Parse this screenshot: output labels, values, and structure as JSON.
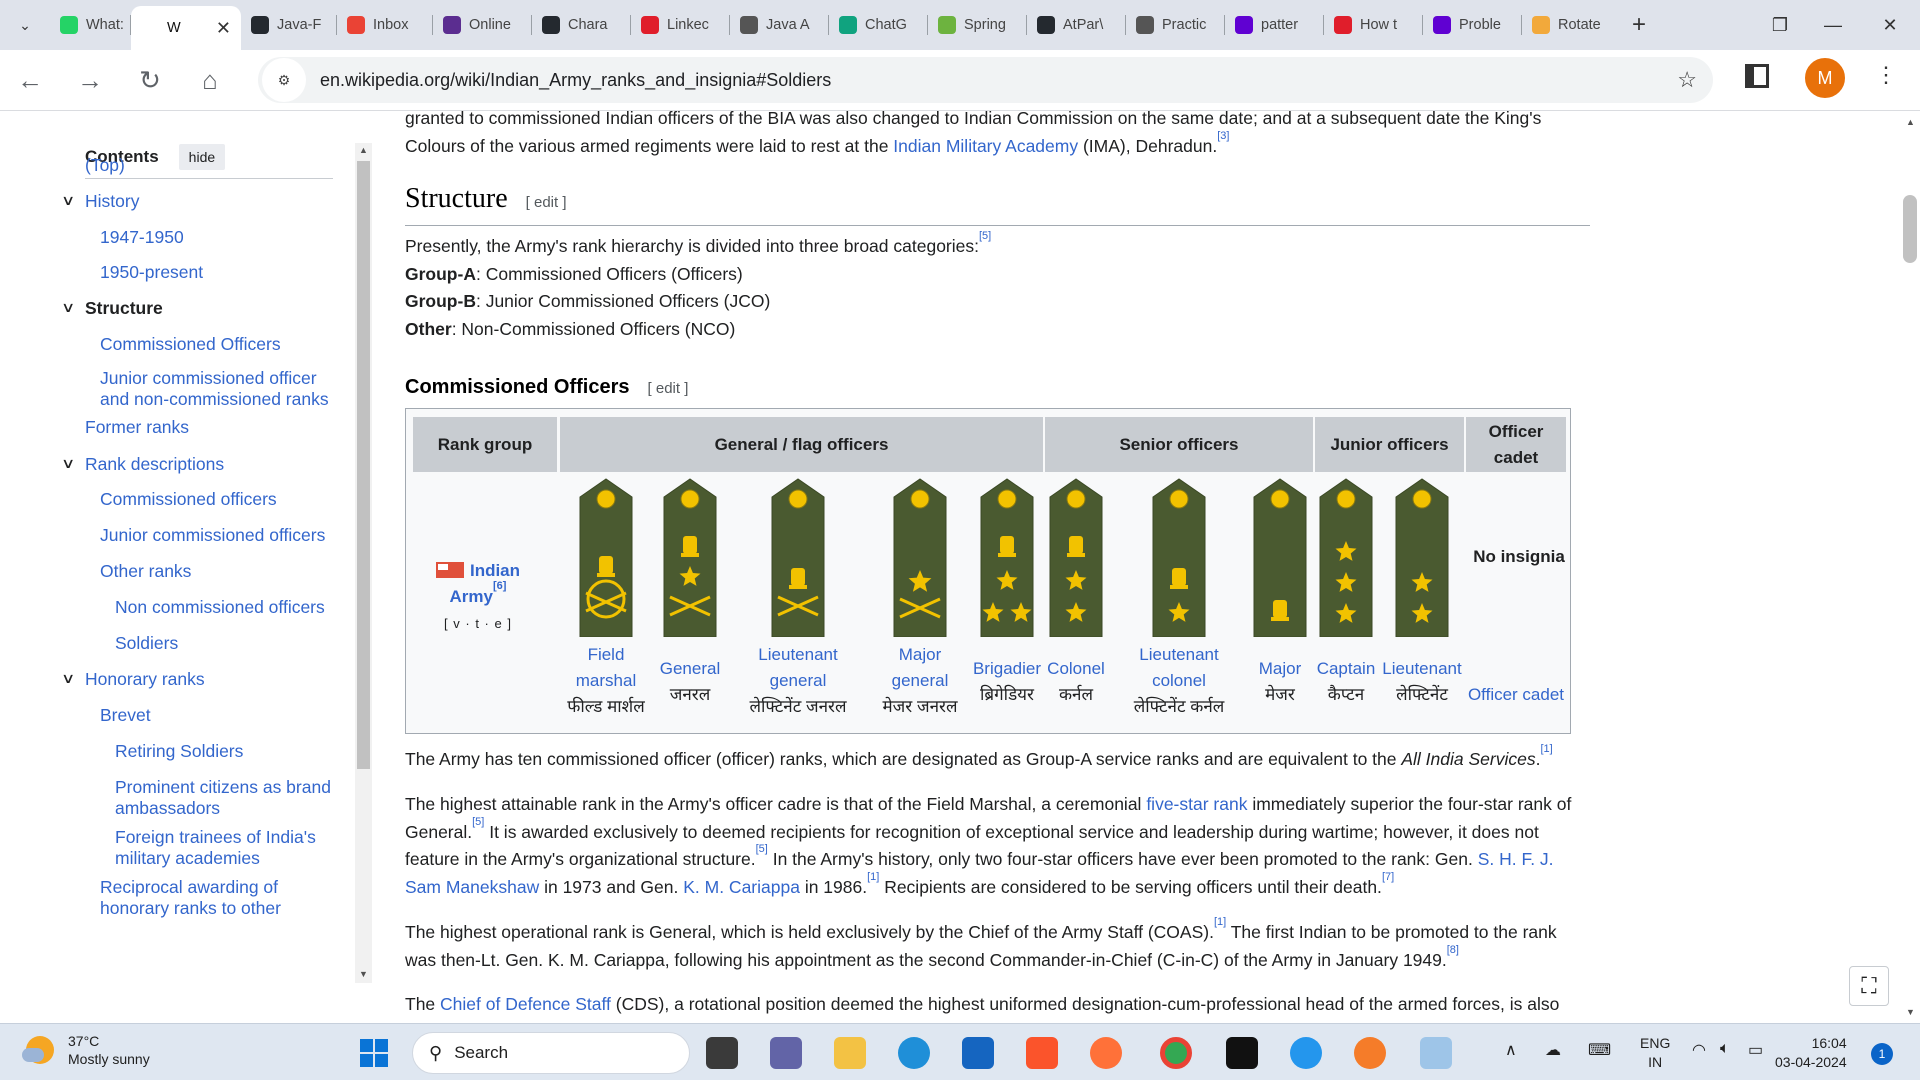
{
  "browser": {
    "tabs": [
      {
        "label": "What:",
        "fav": "whatsapp-icon",
        "color": "#25d366"
      },
      {
        "label": "W",
        "fav": "wikipedia-icon",
        "color": "#ffffff",
        "active": true
      },
      {
        "label": "Java-F",
        "fav": "github-icon",
        "color": "#24292f"
      },
      {
        "label": "Inbox",
        "fav": "gmail-icon",
        "color": "#ea4335"
      },
      {
        "label": "Online",
        "fav": "bolt-icon",
        "color": "#5b2d90"
      },
      {
        "label": "Chara",
        "fav": "github-icon",
        "color": "#24292f"
      },
      {
        "label": "Linkec",
        "fav": "v-icon",
        "color": "#e01e2b"
      },
      {
        "label": "Java A",
        "fav": "globe-icon",
        "color": "#555555"
      },
      {
        "label": "ChatG",
        "fav": "chatgpt-icon",
        "color": "#10a37f"
      },
      {
        "label": "Spring",
        "fav": "spring-icon",
        "color": "#6db33f"
      },
      {
        "label": "AtPar\\",
        "fav": "github-icon",
        "color": "#24292f"
      },
      {
        "label": "Practic",
        "fav": "globe-icon",
        "color": "#555555"
      },
      {
        "label": "patter",
        "fav": "yahoo-icon",
        "color": "#6001d2"
      },
      {
        "label": "How t",
        "fav": "v-icon",
        "color": "#e01e2b"
      },
      {
        "label": "Proble",
        "fav": "yahoo-icon",
        "color": "#6001d2"
      },
      {
        "label": "Rotate",
        "fav": "leaf-icon",
        "color": "#f2a93b"
      }
    ],
    "url": "en.wikipedia.org/wiki/Indian_Army_ranks_and_insignia#Soldiers",
    "avatar_letter": "M",
    "wc_min": "—",
    "wc_max": "❐",
    "wc_close": "✕"
  },
  "toc": {
    "title": "Contents",
    "hide_label": "hide",
    "items": [
      {
        "label": "(Top)",
        "level": 0
      },
      {
        "label": "History",
        "level": 0,
        "chev": true
      },
      {
        "label": "1947-1950",
        "level": 1
      },
      {
        "label": "1950-present",
        "level": 1
      },
      {
        "label": "Structure",
        "level": 0,
        "chev": true,
        "bold": true
      },
      {
        "label": "Commissioned Officers",
        "level": 1
      },
      {
        "label": "Junior commissioned officer and non-commissioned ranks",
        "level": 1,
        "multiline": true
      },
      {
        "label": "Former ranks",
        "level": 0
      },
      {
        "label": "Rank descriptions",
        "level": 0,
        "chev": true
      },
      {
        "label": "Commissioned officers",
        "level": 1
      },
      {
        "label": "Junior commissioned officers",
        "level": 1
      },
      {
        "label": "Other ranks",
        "level": 1
      },
      {
        "label": "Non commissioned officers",
        "level": 2
      },
      {
        "label": "Soldiers",
        "level": 2
      },
      {
        "label": "Honorary ranks",
        "level": 0,
        "chev": true
      },
      {
        "label": "Brevet",
        "level": 1
      },
      {
        "label": "Retiring Soldiers",
        "level": 2
      },
      {
        "label": "Prominent citizens as brand ambassadors",
        "level": 2,
        "multiline": true
      },
      {
        "label": "Foreign trainees of India's military academies",
        "level": 2,
        "multiline": true
      },
      {
        "label": "Reciprocal awarding of honorary ranks to other",
        "level": 1,
        "multiline": true
      }
    ]
  },
  "article": {
    "intro_top": "granted to commissioned Indian officers of the BIA was also changed to Indian Commission on the same date; and at a subsequent date the King's",
    "intro_line2_pre": "Colours of the various armed regiments were laid to rest at the ",
    "intro_link": "Indian Military Academy",
    "intro_line2_post": " (IMA), Dehradun.",
    "ref3": "[3]",
    "structure_heading": "Structure",
    "edit_label": "[ edit ]",
    "structure_intro": "Presently, the Army's rank hierarchy is divided into three broad categories:",
    "ref5": "[5]",
    "groups": [
      {
        "name": "Group-A",
        "desc": ": Commissioned Officers (Officers)"
      },
      {
        "name": "Group-B",
        "desc": ": Junior Commissioned Officers (JCO)"
      },
      {
        "name": "Other",
        "desc": ": Non-Commissioned Officers (NCO)"
      }
    ],
    "co_heading": "Commissioned Officers",
    "table": {
      "headers": [
        "Rank group",
        "General / flag officers",
        "Senior officers",
        "Junior officers",
        "Officer cadet"
      ],
      "army_label": "Indian Army",
      "army_ref": "[6]",
      "vte": "[ v · t · e ]",
      "no_insignia": "No insignia",
      "ranks": [
        {
          "en": "Field marshal",
          "hi": "फील्ड मार्शल"
        },
        {
          "en": "General",
          "hi": "जनरल"
        },
        {
          "en": "Lieutenant general",
          "hi": "लेफ्टिनेंट जनरल"
        },
        {
          "en": "Major general",
          "hi": "मेजर जनरल"
        },
        {
          "en": "Brigadier",
          "hi": "ब्रिगेडियर"
        },
        {
          "en": "Colonel",
          "hi": "कर्नल"
        },
        {
          "en": "Lieutenant colonel",
          "hi": "लेफ्टिनेंट कर्नल"
        },
        {
          "en": "Major",
          "hi": "मेजर"
        },
        {
          "en": "Captain",
          "hi": "कैप्टन"
        },
        {
          "en": "Lieutenant",
          "hi": "लेफ्टिनेंट"
        },
        {
          "en": "Officer cadet",
          "hi": ""
        }
      ]
    },
    "p1_pre": "The Army has ten commissioned officer (officer) ranks, which are designated as Group-A service ranks and are equivalent to the ",
    "p1_em": "All India Services",
    "p1_ref": "[1]",
    "p2_a": "The highest attainable rank in the Army's officer cadre is that of the Field Marshal, a ceremonial ",
    "p2_link1": "five-star rank",
    "p2_b": " immediately superior the four-star rank of General.",
    "p2_ref5": "[5]",
    "p2_c": " It is awarded exclusively to deemed recipients for recognition of exceptional service and leadership during wartime; however, it does not feature in the Army's organizational structure.",
    "p2_ref5b": "[5]",
    "p2_d": " In the Army's history, only two four-star officers have ever been promoted to the rank: Gen. ",
    "p2_link2": "S. H. F. J. Sam Manekshaw",
    "p2_e": " in 1973 and Gen. ",
    "p2_link3": "K. M. Cariappa",
    "p2_f": " in 1986.",
    "p2_ref1": "[1]",
    "p2_g": " Recipients are considered to be serving officers until their death.",
    "p2_ref7": "[7]",
    "p3_a": "The highest operational rank is General, which is held exclusively by the Chief of the Army Staff (COAS).",
    "p3_ref1": "[1]",
    "p3_b": " The first Indian to be promoted to the rank was then-Lt. Gen. K. M. Cariappa, following his appointment as the second Commander-in-Chief (C-in-C) of the Army in January 1949.",
    "p3_ref8": "[8]",
    "p4_a": "The ",
    "p4_link": "Chief of Defence Staff",
    "p4_b": " (CDS), a rotational position deemed the highest uniformed designation-cum-professional head of the armed forces, is also"
  },
  "taskbar": {
    "temp": "37°C",
    "weather": "Mostly sunny",
    "search": "Search",
    "lang1": "ENG",
    "lang2": "IN",
    "time": "16:04",
    "date": "03-04-2024",
    "notif": "1"
  },
  "colors": {
    "link": "#3366cc",
    "epaulette": "#4a5a30",
    "gold": "#f2c200"
  }
}
